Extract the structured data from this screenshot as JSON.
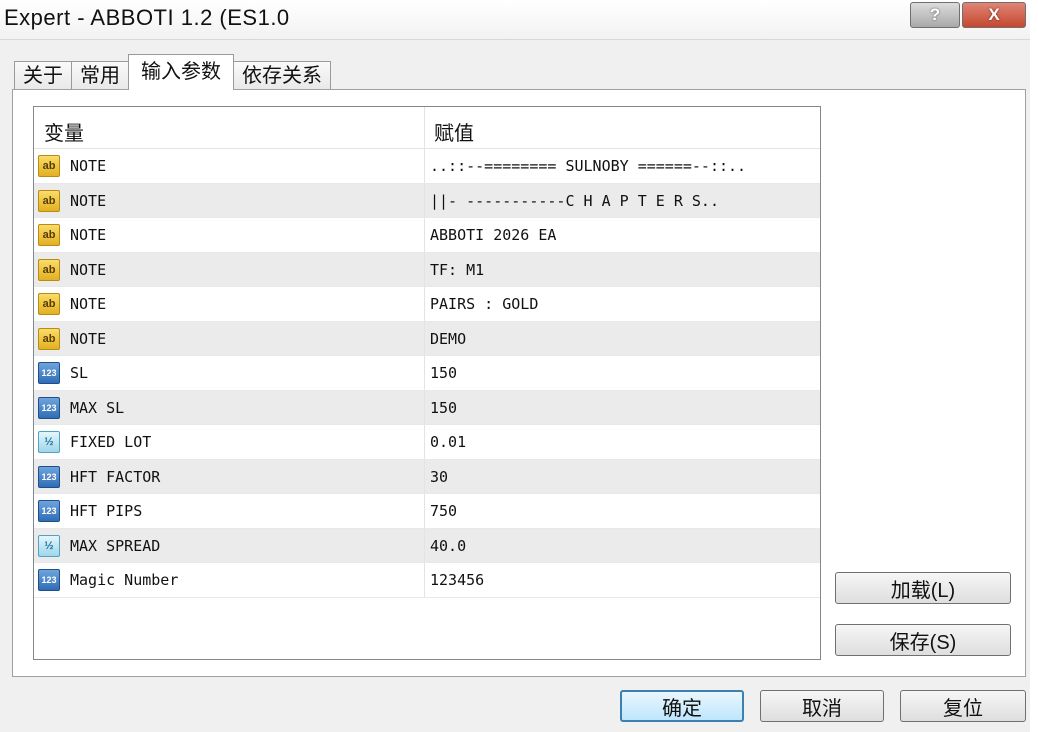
{
  "window": {
    "title": "Expert - ABBOTI 1.2 (ES1.0",
    "help_label": "?",
    "close_label": "X"
  },
  "tabs": [
    {
      "label": "关于"
    },
    {
      "label": "常用"
    },
    {
      "label": "输入参数"
    },
    {
      "label": "依存关系"
    }
  ],
  "table": {
    "col_variable": "变量",
    "col_value": "赋值",
    "rows": [
      {
        "icon": "string-param-icon",
        "icon_text": "ab",
        "name": "NOTE",
        "value": "..::--======== SULNOBY ======--::.."
      },
      {
        "icon": "string-param-icon",
        "icon_text": "ab",
        "name": "NOTE",
        "value": "||-  -----------C H A P T E R  S.."
      },
      {
        "icon": "string-param-icon",
        "icon_text": "ab",
        "name": "NOTE",
        "value": "ABBOTI 2026 EA"
      },
      {
        "icon": "string-param-icon",
        "icon_text": "ab",
        "name": "NOTE",
        "value": "TF: M1"
      },
      {
        "icon": "string-param-icon",
        "icon_text": "ab",
        "name": "NOTE",
        "value": "PAIRS : GOLD"
      },
      {
        "icon": "string-param-icon",
        "icon_text": "ab",
        "name": "NOTE",
        "value": "DEMO"
      },
      {
        "icon": "integer-param-icon",
        "icon_text": "123",
        "name": "SL",
        "value": "150"
      },
      {
        "icon": "integer-param-icon",
        "icon_text": "123",
        "name": "MAX SL",
        "value": "150"
      },
      {
        "icon": "double-param-icon",
        "icon_text": "½",
        "name": "FIXED LOT",
        "value": "0.01"
      },
      {
        "icon": "integer-param-icon",
        "icon_text": "123",
        "name": "HFT FACTOR",
        "value": "30"
      },
      {
        "icon": "integer-param-icon",
        "icon_text": "123",
        "name": "HFT PIPS",
        "value": "750"
      },
      {
        "icon": "double-param-icon",
        "icon_text": "½",
        "name": "MAX SPREAD",
        "value": "40.0"
      },
      {
        "icon": "integer-param-icon",
        "icon_text": "123",
        "name": "Magic Number",
        "value": "123456"
      }
    ]
  },
  "buttons": {
    "load": "加载(L)",
    "save": "保存(S)",
    "ok": "确定",
    "cancel": "取消",
    "reset": "复位"
  }
}
